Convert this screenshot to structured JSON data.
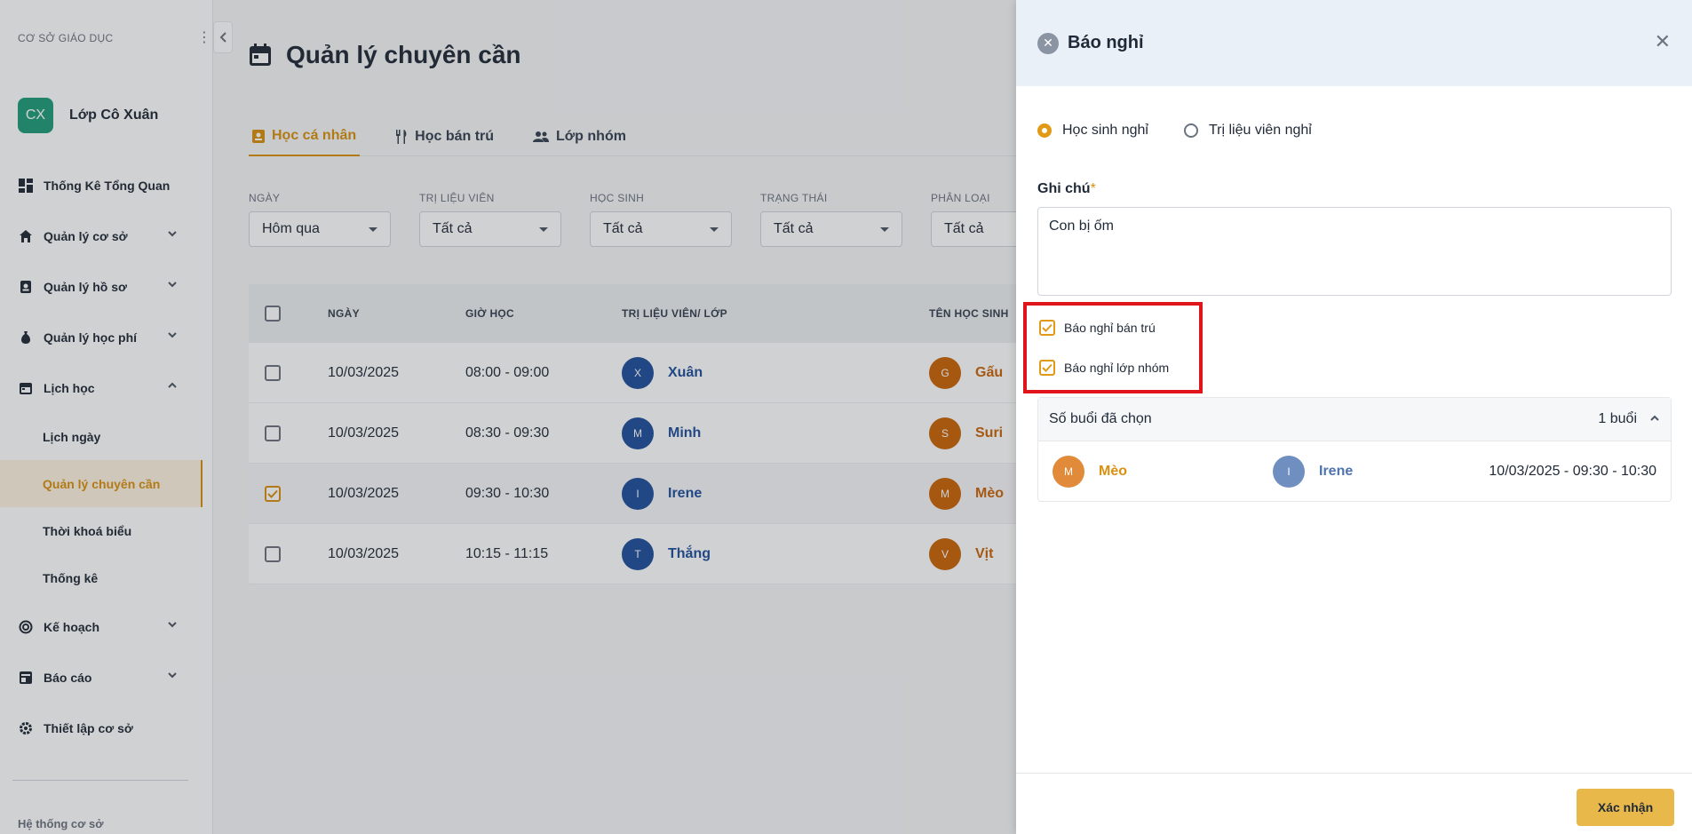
{
  "sidebar": {
    "org_label": "CƠ SỞ GIÁO DỤC",
    "avatar_initials": "CX",
    "profile_name": "Lớp Cô Xuân",
    "items": [
      {
        "label": "Thống Kê Tổng Quan",
        "icon": "dashboard-icon"
      },
      {
        "label": "Quản lý cơ sở",
        "icon": "home-icon"
      },
      {
        "label": "Quản lý hồ sơ",
        "icon": "profile-icon"
      },
      {
        "label": "Quản lý học phí",
        "icon": "money-bag-icon"
      },
      {
        "label": "Lịch học",
        "icon": "calendar-icon"
      }
    ],
    "sub_items": [
      "Lịch ngày",
      "Quản lý chuyên cần",
      "Thời khoá biểu",
      "Thống kê"
    ],
    "items2": [
      {
        "label": "Kế hoạch",
        "icon": "target-icon"
      },
      {
        "label": "Báo cáo",
        "icon": "report-icon"
      },
      {
        "label": "Thiết lập cơ sở",
        "icon": "gear-icon"
      }
    ],
    "footer": "Hệ thống cơ sở"
  },
  "main": {
    "title": "Quản lý chuyên cần",
    "tabs": [
      "Học cá nhân",
      "Học bán trú",
      "Lớp nhóm"
    ],
    "filters": [
      {
        "label": "NGÀY",
        "value": "Hôm qua"
      },
      {
        "label": "TRỊ LIỆU VIÊN",
        "value": "Tất cả"
      },
      {
        "label": "HỌC SINH",
        "value": "Tất cả"
      },
      {
        "label": "TRẠNG THÁI",
        "value": "Tất cả"
      },
      {
        "label": "PHÂN LOẠI",
        "value": "Tất cả"
      }
    ],
    "table": {
      "headers": [
        "NGÀY",
        "GIỜ HỌC",
        "TRỊ LIỆU VIÊN/ LỚP",
        "TÊN HỌC SINH"
      ],
      "rows": [
        {
          "date": "10/03/2025",
          "time": "08:00 - 09:00",
          "teacher_initial": "X",
          "teacher": "Xuân",
          "student_initial": "G",
          "student": "Gấu"
        },
        {
          "date": "10/03/2025",
          "time": "08:30 - 09:30",
          "teacher_initial": "M",
          "teacher": "Minh",
          "student_initial": "S",
          "student": "Suri"
        },
        {
          "date": "10/03/2025",
          "time": "09:30 - 10:30",
          "teacher_initial": "I",
          "teacher": "Irene",
          "student_initial": "M",
          "student": "Mèo"
        },
        {
          "date": "10/03/2025",
          "time": "10:15 - 11:15",
          "teacher_initial": "T",
          "teacher": "Thắng",
          "student_initial": "V",
          "student": "Vịt"
        }
      ]
    }
  },
  "drawer": {
    "title": "Báo nghỉ",
    "radios": [
      "Học sinh nghỉ",
      "Trị liệu viên nghỉ"
    ],
    "note_label": "Ghi chú",
    "note_required": "*",
    "note_value": "Con bị ốm",
    "checkboxes": [
      "Báo nghỉ bán trú",
      "Báo nghỉ lớp nhóm"
    ],
    "sessions": {
      "label": "Số buổi đã chọn",
      "count": "1 buổi",
      "rows": [
        {
          "student_initial": "M",
          "student": "Mèo",
          "teacher_initial": "I",
          "teacher": "Irene",
          "time": "10/03/2025 - 09:30 - 10:30"
        }
      ]
    },
    "confirm_label": "Xác nhận"
  },
  "colors": {
    "accent": "#d9900f",
    "highlight_border": "#e0141b",
    "teacher_blue": "#1f4f9c",
    "student_orange": "#c96508"
  }
}
